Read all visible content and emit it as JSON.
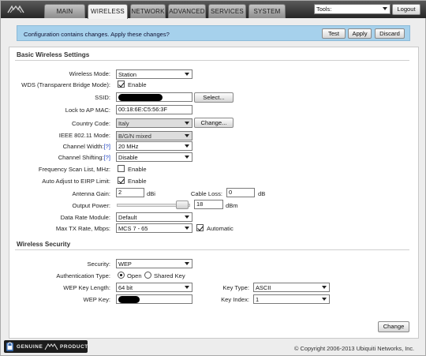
{
  "nav": {
    "tabs": [
      {
        "label": "MAIN"
      },
      {
        "label": "WIRELESS"
      },
      {
        "label": "NETWORK"
      },
      {
        "label": "ADVANCED"
      },
      {
        "label": "SERVICES"
      },
      {
        "label": "SYSTEM"
      }
    ],
    "active_tab": "WIRELESS",
    "tools_label": "Tools:",
    "logout_label": "Logout"
  },
  "alert": {
    "message": "Configuration contains changes. Apply these changes?",
    "test_label": "Test",
    "apply_label": "Apply",
    "discard_label": "Discard"
  },
  "basic": {
    "title": "Basic Wireless Settings",
    "wireless_mode": {
      "label": "Wireless Mode:",
      "value": "Station"
    },
    "wds": {
      "label": "WDS (Transparent Bridge Mode):",
      "checked": true,
      "option": "Enable"
    },
    "ssid": {
      "label": "SSID:",
      "select_label": "Select..."
    },
    "lock_ap": {
      "label": "Lock to AP MAC:",
      "value": "00:18:6E:C5:56:3F"
    },
    "country": {
      "label": "Country Code:",
      "value": "Italy",
      "change_label": "Change..."
    },
    "ieee_mode": {
      "label": "IEEE 802.11 Mode:",
      "value": "B/G/N mixed"
    },
    "channel_width": {
      "label": "Channel Width:",
      "help": "[?]",
      "value": "20 MHz"
    },
    "channel_shifting": {
      "label": "Channel Shifting:",
      "help": "[?]",
      "value": "Disable"
    },
    "freq_scan": {
      "label": "Frequency Scan List, MHz:",
      "checked": false,
      "option": "Enable"
    },
    "auto_eirp": {
      "label": "Auto Adjust to EIRP Limit:",
      "checked": true,
      "option": "Enable"
    },
    "antenna_gain": {
      "label": "Antenna Gain:",
      "value": "2",
      "unit": "dBi"
    },
    "cable_loss": {
      "label": "Cable Loss:",
      "value": "0",
      "unit": "dB"
    },
    "output_power": {
      "label": "Output Power:",
      "value": "18",
      "unit": "dBm"
    },
    "data_rate_module": {
      "label": "Data Rate Module:",
      "value": "Default"
    },
    "max_tx_rate": {
      "label": "Max TX Rate, Mbps:",
      "value": "MCS 7 - 65",
      "auto_checked": true,
      "auto_label": "Automatic"
    }
  },
  "security": {
    "title": "Wireless Security",
    "security": {
      "label": "Security:",
      "value": "WEP"
    },
    "auth_type": {
      "label": "Authentication Type:",
      "options": [
        "Open",
        "Shared Key"
      ],
      "selected": "Open"
    },
    "wep_key_length": {
      "label": "WEP Key Length:",
      "value": "64 bit"
    },
    "key_type": {
      "label": "Key Type:",
      "value": "ASCII"
    },
    "wep_key": {
      "label": "WEP Key:"
    },
    "key_index": {
      "label": "Key Index:",
      "value": "1"
    },
    "change_label": "Change"
  },
  "footer": {
    "badge_left": "GENUINE",
    "badge_right": "PRODUCT",
    "copyright": "© Copyright 2006-2013 Ubiquiti Networks, Inc."
  },
  "colors": {
    "topbar": "#2e2e2e",
    "alert_bg": "#a6d1ec",
    "panel_bg": "#ffffff",
    "help_link": "#1a3fbf"
  },
  "icons": [
    "ubiquiti-logo-icon",
    "chevron-down-icon",
    "lock-icon"
  ]
}
